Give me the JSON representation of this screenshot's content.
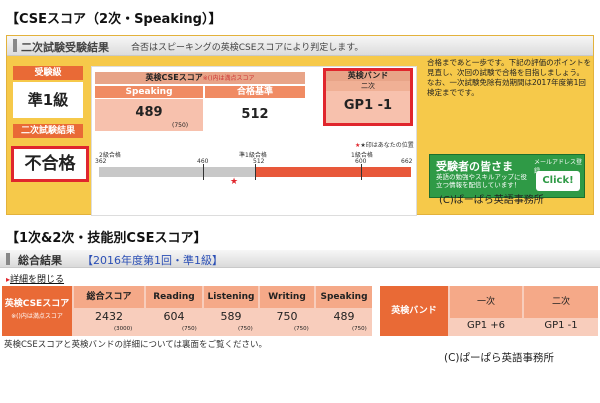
{
  "heading1": "【CSEスコア（2次・Speaking）】",
  "heading2": "【1次&2次・技能別CSEスコア】",
  "panel1": {
    "title": "二次試験受験結果",
    "note": "合否はスピーキングの英検CSEスコアにより判定します。",
    "grade_label": "受験級",
    "grade_value": "準1級",
    "result_label": "二次試験結果",
    "result_value": "不合格",
    "cse_header": "英検CSEスコア",
    "cse_header_note": "※()内は満点スコア",
    "speaking_label": "Speaking",
    "speaking_value": "489",
    "speaking_max": "(750)",
    "pass_label": "合格基準",
    "pass_value": "512",
    "band_label": "英検バンド",
    "band_sub": "二次",
    "band_value": "GP1 -1",
    "legend": "★印はあなたの位置",
    "scale_labels": [
      "362",
      "2級合格",
      "460",
      "準1級合格",
      "512",
      "1級合格",
      "600",
      "662"
    ],
    "side_text": "合格まであと一歩です。下記の評価のポイントを見直し、次回の試験で合格を目指しましょう。\nなお、一次試験免除有効期間は2017年度第1回検定までです。",
    "banner_title": "受験者の皆さま",
    "banner_sub": "メールアドレス登録",
    "banner_body": "英語の勉強やスキルアップに役立つ情報を配信しています！",
    "banner_click": "Click!",
    "copyright": "(C)ぱーぱら英語事務所"
  },
  "panel2": {
    "title": "総合結果",
    "session": "【2016年度第1回・準1級】",
    "detail_link": "詳細を閉じる",
    "row_label": "英検CSEスコア",
    "row_note": "※()内は満点スコア",
    "columns": [
      {
        "label": "総合スコア",
        "value": "2432",
        "max": "(3000)"
      },
      {
        "label": "Reading",
        "value": "604",
        "max": "(750)"
      },
      {
        "label": "Listening",
        "value": "589",
        "max": "(750)"
      },
      {
        "label": "Writing",
        "value": "750",
        "max": "(750)"
      },
      {
        "label": "Speaking",
        "value": "489",
        "max": "(750)"
      }
    ],
    "band_label": "英検バンド",
    "band_col1": "一次",
    "band_col2": "二次",
    "band_val1": "GP1 +6",
    "band_val2": "GP1 -1",
    "footnote": "英検CSEスコアと英検バンドの詳細については裏面をご覧ください。",
    "copyright": "(C)ぱーぱら英語事務所"
  },
  "colors": {
    "accent": "#e96a36",
    "header": "#f08b63",
    "value_bg": "#f7c1ad",
    "frame": "#f6c94a",
    "red": "#e0262d",
    "green": "#2f9a46"
  }
}
